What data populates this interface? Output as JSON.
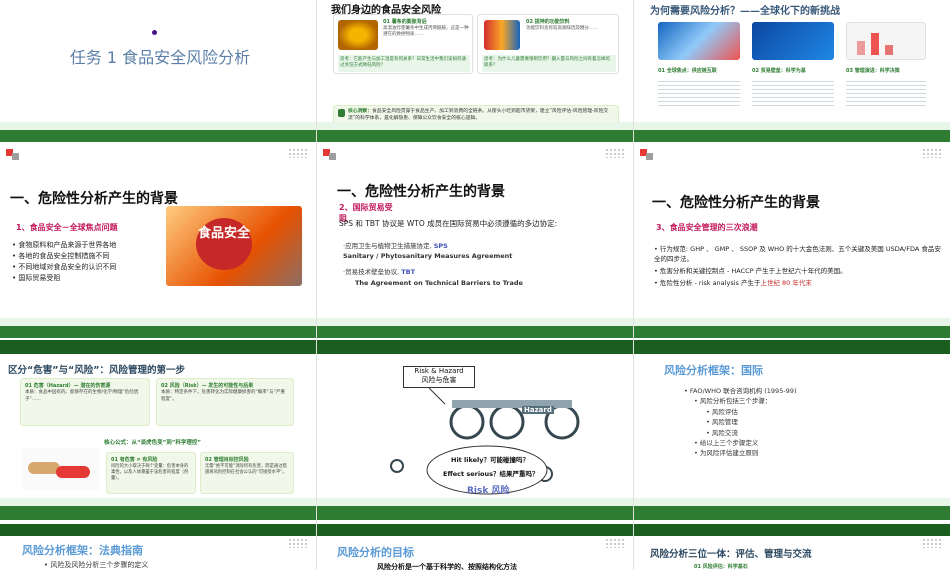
{
  "s1": {
    "title": "任务 1  食品安全风险分析"
  },
  "s2": {
    "title": "我们身边的食品安全风险",
    "card1_head": "01 薯条的膨胀背后",
    "card1_body": "高温油炸使薯条中生成丙烯酰胺，这是一种潜在的致癌物质……",
    "card1_q": "思考：它能产生与加工温度有何关系？日常生活中我们该如何通过烹饪方式降低风险？",
    "card2_head": "02 提神的功能饮料",
    "card2_body": "功能饮料含有较高咖啡因及糖分……",
    "card2_q": "思考：为什么儿童需要限制饮用？摄入量与风险之间有着怎样的联系？",
    "core_label": "核心洞察：",
    "core": "食品安全风险贯穿于食品生产、加工到消费的全链条。从街头小吃到超市货架，建立“风险评估-风险管理-风险交流”的科学体系，是化解隐患、保障公众饮食安全的核心逻辑。"
  },
  "s3": {
    "title": "为何需要风险分析？——全球化下的新挑战",
    "c1": "01 全球焦点：供应链互联",
    "c2": "02 贸易壁垒：科学为基",
    "c3": "03 管理演进：科学决策"
  },
  "s4": {
    "title": "一、危险性分析产生的背景",
    "subtitle": "1、食品安全－全球焦点问题",
    "bullets": [
      "食物原料和产品来源于世界各地",
      "各地的食品安全控制措施不同",
      "不同地域对食品安全的认识不同",
      "国际贸易受阻"
    ],
    "img_text": "食品安全"
  },
  "s5": {
    "title": "一、危险性分析产生的背景",
    "subtitle": "2、国际贸易受阻",
    "lead": "SPS 和 TBT 协议是 WTO 成员在国际贸易中必须遵循的多边协定:",
    "b1": "·应用卫生与植物卫生措施协定,",
    "b1_abbr": "SPS",
    "b1_en": "Sanitary / Phytosanitary Measures Agreement",
    "b2": "·贸易技术壁垒协议,",
    "b2_abbr": "TBT",
    "b2_en": "The Agreement on Technical Barriers to Trade"
  },
  "s6": {
    "title": "一、危险性分析产生的背景",
    "subtitle": "3、食品安全管理的三次浪潮",
    "b1": "行为规范:  GHP 、 GMP 、 SSOP 及 WHO 的十大金色法则、五个关键及美国 USDA/FDA 食品安全的四步法。",
    "b2": "危害分析和关键控制点 - HACCP   产生于上世纪六十年代的美国。",
    "b3a": "危险性分析 - risk analysis   产生于",
    "b3b": "上世纪 80 年代末"
  },
  "s7": {
    "title": "区分“危害”与“风险”：风险管理的第一步",
    "h1": "01 危害（Hazard）— 潜在的伤害源",
    "h1_body": "本质：食品中固有的、能够存在的生物/化学/物理“危险因子”……",
    "h2": "02 风险（Risk）— 发生的可能性与后果",
    "h2_body": "本质：特定条件下，危害转化为实际健康损害的“概率”与“严重程度”。",
    "mid": "核心公式：从“谈虎色变”到“科学理控”",
    "h3": "01 有危害 ≠ 有风险",
    "h3_body": "风险的大小取决于两个变量：危害本身的毒性，以及人体暴露于该危害的程度（剂量）。",
    "h4": "02 管理目标控风险",
    "h4_body": "无需“绝不可能”消除所有危害，而是通过措施将风险控制在社会公认的“可接受水平”。"
  },
  "s8": {
    "box_en": "Risk & Hazard",
    "box_cn": "风险与危害",
    "q1": "Hit  likely？可能碰撞吗？",
    "q2": "Effect  serious？结果严重吗？",
    "risk": "Risk 风险",
    "hazard": "Hazard"
  },
  "s9": {
    "title": "风险分析框架：国际",
    "items": [
      "FAO/WHO 联合咨询机构 (1995-99)",
      "风险分析包括三个步骤：",
      "风险评估",
      "风险管理",
      "风险交流",
      "给以上三个步骤定义",
      "为风险评估建立原则"
    ]
  },
  "s10": {
    "title": "风险分析框架：法典指南",
    "line": "风险及风险分析三个步骤的定义"
  },
  "s11": {
    "title": "风险分析的目标",
    "line": "风险分析是一个基于科学的、按照结构化方法"
  },
  "s12": {
    "title": "风险分析三位一体：评估、管理与交流",
    "line": "01 风险评估：科学基石"
  }
}
